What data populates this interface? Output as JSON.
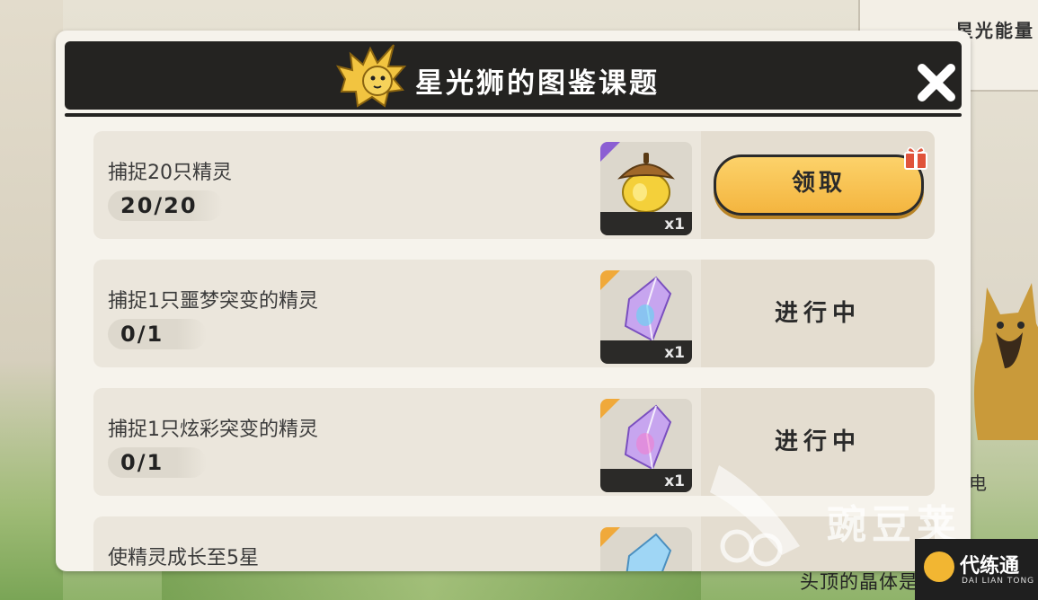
{
  "dialog": {
    "title": "星光狮的图鉴课题",
    "close_icon": "close-icon"
  },
  "tasks": [
    {
      "title": "捕捉20只精灵",
      "progress": "20/20",
      "reward_count": "x1",
      "reward_icon": "acorn-icon",
      "action": "领取",
      "state": "claimable"
    },
    {
      "title": "捕捉1只噩梦突变的精灵",
      "progress": "0/1",
      "reward_count": "x1",
      "reward_icon": "crystal-icon",
      "action": "进行中",
      "state": "in-progress"
    },
    {
      "title": "捕捉1只炫彩突变的精灵",
      "progress": "0/1",
      "reward_count": "x1",
      "reward_icon": "crystal-icon",
      "action": "进行中",
      "state": "in-progress"
    },
    {
      "title": "使精灵成长至5星",
      "progress": "",
      "reward_count": "",
      "reward_icon": "crystal-icon",
      "action": "",
      "state": "partial"
    }
  ],
  "background": {
    "card_title": "星光能量",
    "side_text": "电",
    "bottom_text": "头顶的晶体是"
  },
  "watermark": {
    "text": "豌豆荚",
    "badge_name": "代练通",
    "badge_sub": "DAI LIAN TONG"
  }
}
